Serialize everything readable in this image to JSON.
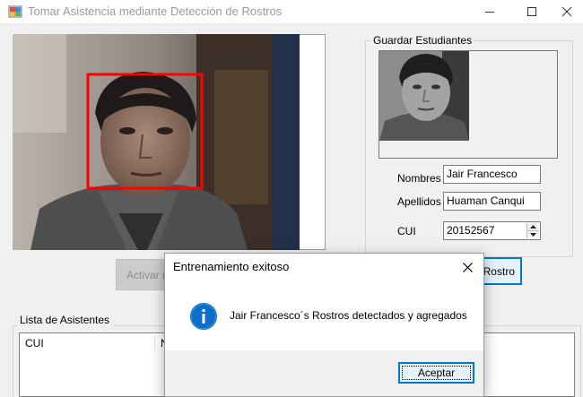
{
  "window": {
    "title": "Tomar Asistencia mediante Detección de Rostros"
  },
  "groupbox": {
    "label": "Guardar Estudiantes"
  },
  "form": {
    "nombres_label": "Nombres",
    "nombres_value": "Jair Francesco",
    "apellidos_label": "Apellidos",
    "apellidos_value": "Huaman Canqui",
    "cui_label": "CUI",
    "cui_value": "20152567"
  },
  "buttons": {
    "activar_label": "Activar re",
    "rostro_label": "r Rostro"
  },
  "attendance": {
    "label": "Lista de Asistentes",
    "columns": [
      "CUI",
      "N"
    ]
  },
  "dialog": {
    "title": "Entrenamiento exitoso",
    "message": "Jair Francesco´s Rostros detectados y agregados",
    "ok_label": "Aceptar"
  },
  "colors": {
    "face_box": "#ff0000",
    "accent": "#0078d7",
    "info_icon": "#0a6fc9"
  },
  "icons": [
    "app-icon",
    "minimize-icon",
    "maximize-icon",
    "close-icon",
    "spin-up-icon",
    "spin-down-icon",
    "info-icon",
    "dialog-close-icon"
  ]
}
